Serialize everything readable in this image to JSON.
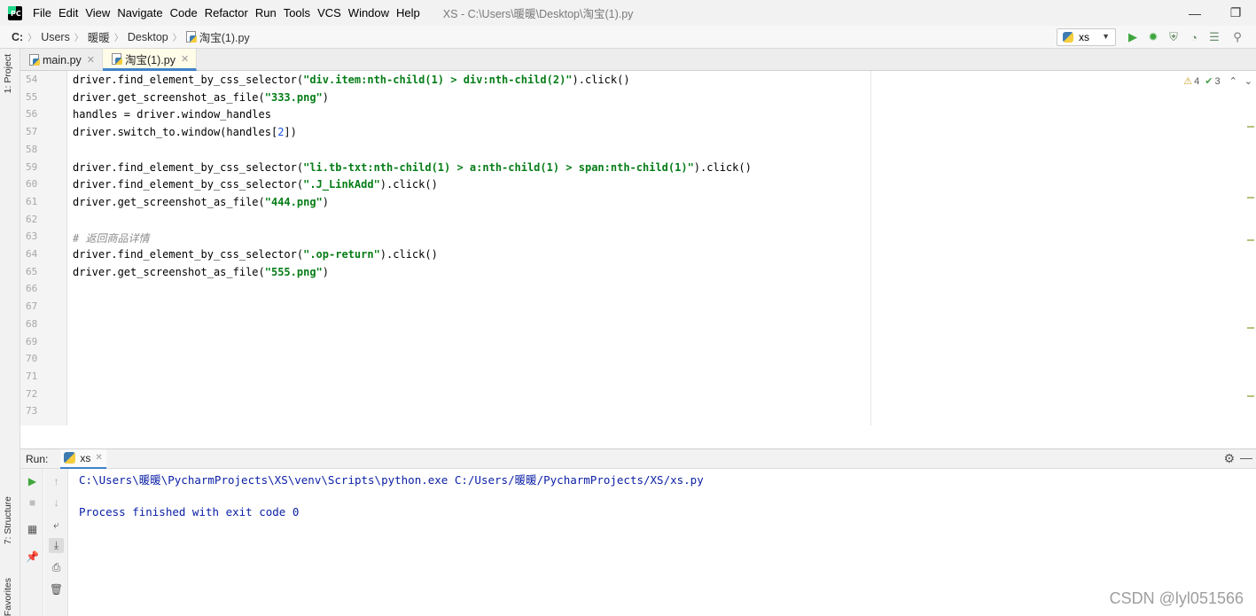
{
  "menubar": {
    "items": [
      "File",
      "Edit",
      "View",
      "Navigate",
      "Code",
      "Refactor",
      "Run",
      "Tools",
      "VCS",
      "Window",
      "Help"
    ],
    "title": "XS - C:\\Users\\暖暖\\Desktop\\淘宝(1).py",
    "minimize": "—",
    "restore": "❐"
  },
  "navbar": {
    "crumbs": [
      "C:",
      "Users",
      "暖暖",
      "Desktop",
      "淘宝(1).py"
    ]
  },
  "run_config": {
    "name": "xs"
  },
  "left_strip": {
    "project_tab": "1: Project",
    "structure_tab": "7: Structure",
    "favorites_tab": "Favorites"
  },
  "tabs": [
    {
      "label": "main.py",
      "active": false
    },
    {
      "label": "淘宝(1).py",
      "active": true
    }
  ],
  "editor": {
    "inspection": {
      "warnings": "4",
      "weak_warnings": "3"
    },
    "lines": [
      {
        "n": "54",
        "text": "driver.find_element_by_css_selector(\"div.item:nth-child(1) > div:nth-child(2)\").click()"
      },
      {
        "n": "55",
        "text": "driver.get_screenshot_as_file(\"333.png\")"
      },
      {
        "n": "56",
        "text": "handles = driver.window_handles"
      },
      {
        "n": "57",
        "text": "driver.switch_to.window(handles[2])"
      },
      {
        "n": "58",
        "text": ""
      },
      {
        "n": "59",
        "text": "driver.find_element_by_css_selector(\"li.tb-txt:nth-child(1) > a:nth-child(1) > span:nth-child(1)\").click()"
      },
      {
        "n": "60",
        "text": "driver.find_element_by_css_selector(\".J_LinkAdd\").click()"
      },
      {
        "n": "61",
        "text": "driver.get_screenshot_as_file(\"444.png\")"
      },
      {
        "n": "62",
        "text": ""
      },
      {
        "n": "63",
        "text": "# 返回商品详情"
      },
      {
        "n": "64",
        "text": "driver.find_element_by_css_selector(\".op-return\").click()"
      },
      {
        "n": "65",
        "text": "driver.get_screenshot_as_file(\"555.png\")"
      },
      {
        "n": "66",
        "text": ""
      },
      {
        "n": "67",
        "text": ""
      },
      {
        "n": "68",
        "text": ""
      },
      {
        "n": "69",
        "text": ""
      },
      {
        "n": "70",
        "text": ""
      },
      {
        "n": "71",
        "text": ""
      },
      {
        "n": "72",
        "text": ""
      },
      {
        "n": "73",
        "text": ""
      }
    ]
  },
  "run_panel": {
    "label": "Run:",
    "tab": "xs",
    "console": [
      "C:\\Users\\暖暖\\PycharmProjects\\XS\\venv\\Scripts\\python.exe C:/Users/暖暖/PycharmProjects/XS/xs.py",
      "",
      "Process finished with exit code 0"
    ]
  },
  "watermark": "CSDN @lyl051566",
  "colors": {
    "accent": "#4083c9",
    "string": "#067d17",
    "number": "#1750eb",
    "console_text": "#0b20a6",
    "run_green": "#3fa63f"
  }
}
